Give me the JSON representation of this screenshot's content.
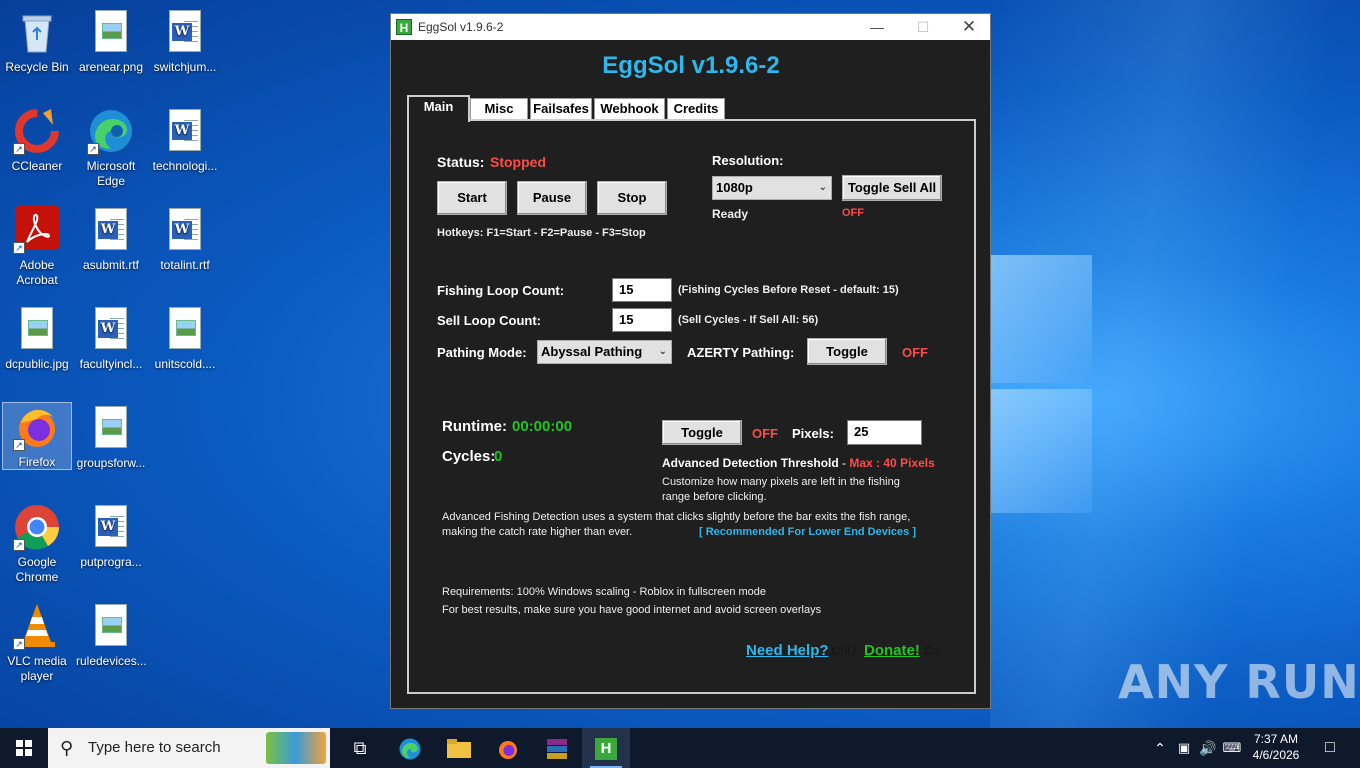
{
  "desktop": {
    "icons": [
      {
        "label": "Recycle Bin"
      },
      {
        "label": "arenear.png"
      },
      {
        "label": "switchjum..."
      },
      {
        "label": "CCleaner"
      },
      {
        "label": "Microsoft Edge"
      },
      {
        "label": "technologi..."
      },
      {
        "label": "Adobe Acrobat"
      },
      {
        "label": "asubmit.rtf"
      },
      {
        "label": "totalint.rtf"
      },
      {
        "label": "dcpublic.jpg"
      },
      {
        "label": "facultyincl..."
      },
      {
        "label": "unitscold...."
      },
      {
        "label": "Firefox"
      },
      {
        "label": "groupsforw..."
      },
      {
        "label": "Google Chrome"
      },
      {
        "label": "putprogra..."
      },
      {
        "label": "VLC media player"
      },
      {
        "label": "ruledevices..."
      }
    ],
    "watermark": "ANY RUN"
  },
  "window": {
    "title": "EggSol v1.9.6-2",
    "icon_letter": "H",
    "heading": "EggSol v1.9.6-2"
  },
  "tabs": [
    {
      "label": "Main"
    },
    {
      "label": "Misc"
    },
    {
      "label": "Failsafes"
    },
    {
      "label": "Webhook"
    },
    {
      "label": "Credits"
    }
  ],
  "main": {
    "status_label": "Status:",
    "status_value": "Stopped",
    "start_label": "Start",
    "pause_label": "Pause",
    "stop_label": "Stop",
    "hotkeys": "Hotkeys: F1=Start - F2=Pause - F3=Stop",
    "resolution_label": "Resolution:",
    "resolution_value": "1080p",
    "ready_text": "Ready",
    "toggle_sell_all_label": "Toggle Sell All",
    "sell_all_state": "OFF",
    "fishing_loop_label": "Fishing Loop Count:",
    "fishing_loop_value": "15",
    "fishing_loop_hint": "(Fishing Cycles Before Reset - default: 15)",
    "sell_loop_label": "Sell Loop Count:",
    "sell_loop_value": "15",
    "sell_loop_hint": "(Sell Cycles  -  If Sell All: 56)",
    "pathing_mode_label": "Pathing Mode:",
    "pathing_mode_value": "Abyssal Pathing",
    "azerty_label": "AZERTY Pathing:",
    "azerty_toggle_label": "Toggle",
    "azerty_state": "OFF",
    "runtime_label": "Runtime:",
    "runtime_value": "00:00:00",
    "cycles_label": "Cycles:",
    "cycles_value": "0",
    "detection_toggle_label": "Toggle",
    "detection_state": "OFF",
    "pixels_label": "Pixels:",
    "pixels_value": "25",
    "adv_threshold_label": "Advanced Detection Threshold",
    "adv_threshold_dash": " - ",
    "adv_threshold_max": "Max : 40 Pixels",
    "customize_line1": "Customize how many pixels are left in the fishing",
    "customize_line2": "range before clicking.",
    "adv_desc_line1": "Advanced Fishing Detection uses a system that clicks slightly before the bar exits the fish range,",
    "adv_desc_line2": "making the catch rate higher than ever.",
    "recommended": "[ Recommended For Lower End Devices ]",
    "req_line1": "Requirements: 100% Windows scaling - Roblox in fullscreen mode",
    "req_line2": "For best results, make sure you have good internet and avoid screen overlays",
    "need_help": "Need Help?",
    "path1": "C:\\U",
    "donate": "Donate!",
    "path2": "C:\\"
  },
  "taskbar": {
    "search_placeholder": "Type here to search",
    "time": "7:37 AM",
    "date": "4/6/2026"
  },
  "colors": {
    "accent_cyan": "#2fb6ea",
    "status_red": "#ff4b4b",
    "status_green": "#22c323",
    "panel_bg": "#1f1f1f"
  }
}
